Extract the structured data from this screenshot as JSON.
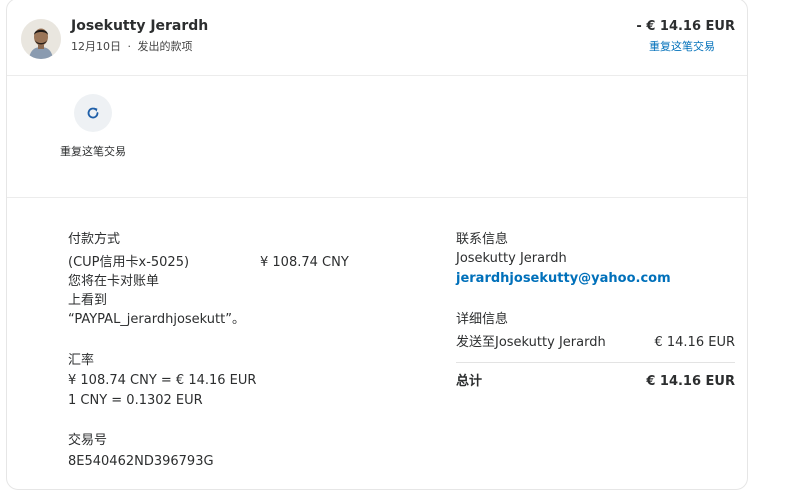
{
  "header": {
    "name": "Josekutty Jerardh",
    "date": "12月10日",
    "separator": "·",
    "type": "发出的款项",
    "amount": "- € 14.16 EUR",
    "repeat_link": "重复这笔交易"
  },
  "actions": {
    "repeat_label": "重复这笔交易"
  },
  "payment": {
    "title": "付款方式",
    "method": "(CUP信用卡x-5025)",
    "method_amount": "¥ 108.74 CNY",
    "note_line1": "您将在卡对账单",
    "note_line2": "上看到",
    "note_line3": "“PAYPAL_jerardhjosekutt”。"
  },
  "exchange": {
    "title": "汇率",
    "line1": "¥ 108.74 CNY = € 14.16 EUR",
    "line2": "1 CNY = 0.1302 EUR"
  },
  "transaction": {
    "title": "交易号",
    "id": "8E540462ND396793G"
  },
  "contact": {
    "title": "联系信息",
    "name": "Josekutty Jerardh",
    "email": "jerardhjosekutty@yahoo.com"
  },
  "detail": {
    "title": "详细信息",
    "sent_to_label": "发送至Josekutty Jerardh",
    "sent_to_amount": "€ 14.16 EUR",
    "total_label": "总计",
    "total_amount": "€ 14.16 EUR"
  },
  "colors": {
    "link": "#0070ba",
    "text": "#2c2e2f"
  },
  "icons": {
    "avatar": "person-photo",
    "repeat": "refresh-icon"
  }
}
